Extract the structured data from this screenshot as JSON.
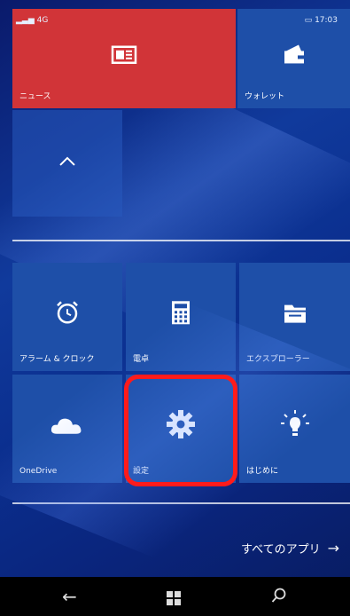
{
  "status": {
    "signal": "4G",
    "time": "17:03"
  },
  "tiles": {
    "news": {
      "label": "ニュース"
    },
    "wallet": {
      "label": "ウォレット"
    },
    "alarm": {
      "label": "アラーム & クロック"
    },
    "calc": {
      "label": "電卓"
    },
    "explorer": {
      "label": "エクスプローラー"
    },
    "onedrive": {
      "label": "OneDrive"
    },
    "settings": {
      "label": "設定"
    },
    "getstarted": {
      "label": "はじめに"
    }
  },
  "all_apps_label": "すべてのアプリ",
  "colors": {
    "news_red": "#d13438",
    "tile_blue": "#1e4fa8",
    "highlight": "#ff1b1b"
  }
}
